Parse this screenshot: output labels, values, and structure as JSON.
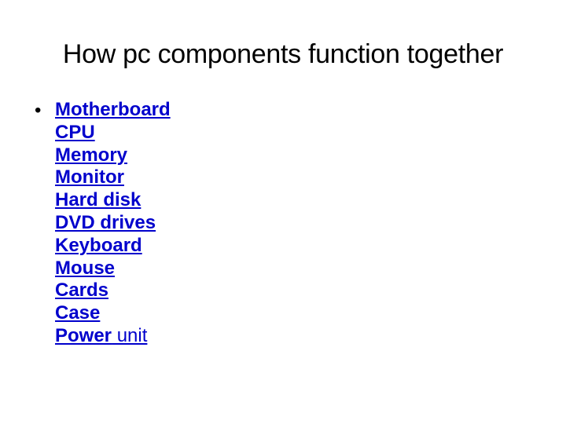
{
  "slide": {
    "title": "How pc components function together",
    "bullet_glyph": "•",
    "link_color": "#0000cc",
    "items": [
      {
        "bold": "Motherboard",
        "regular": ""
      },
      {
        "bold": "CPU",
        "regular": ""
      },
      {
        "bold": "Memory",
        "regular": ""
      },
      {
        "bold": "Monitor",
        "regular": ""
      },
      {
        "bold": "Hard disk",
        "regular": ""
      },
      {
        "bold": "DVD drives",
        "regular": ""
      },
      {
        "bold": "Keyboard",
        "regular": ""
      },
      {
        "bold": "Mouse",
        "regular": ""
      },
      {
        "bold": "Cards",
        "regular": ""
      },
      {
        "bold": "Case",
        "regular": ""
      },
      {
        "bold": "Power",
        "regular": " unit"
      }
    ]
  }
}
